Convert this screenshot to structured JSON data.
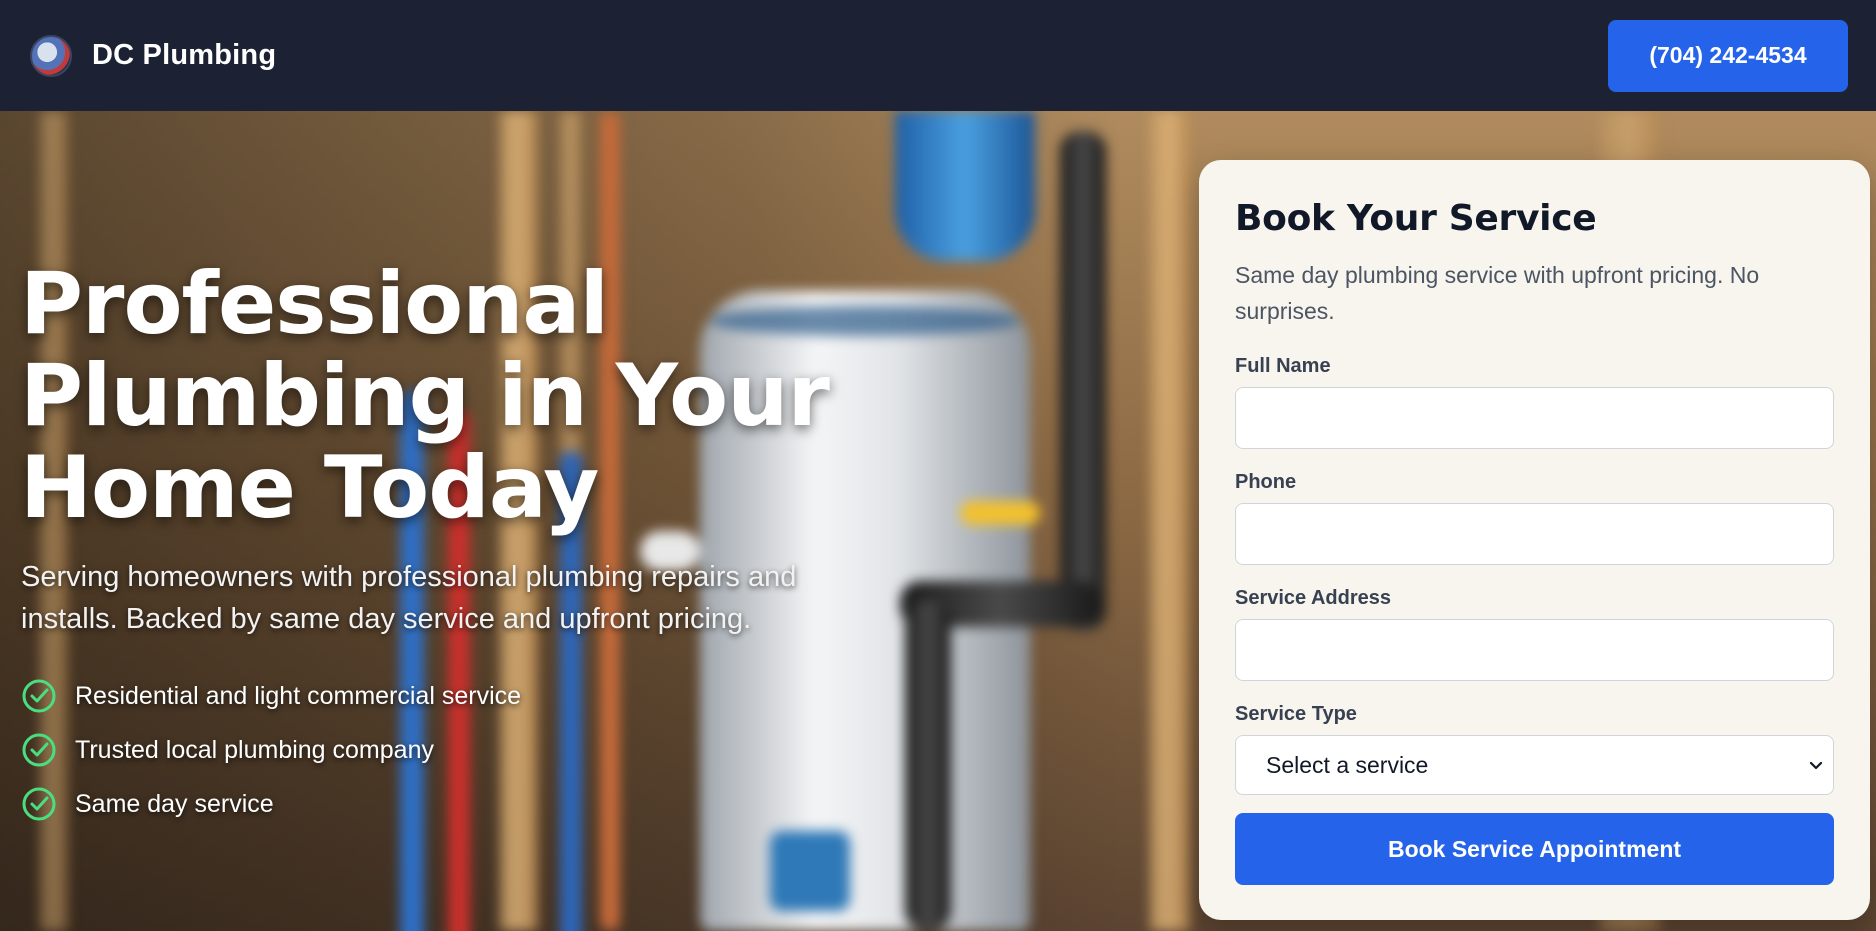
{
  "header": {
    "brand_name": "DC Plumbing",
    "phone_label": "(704) 242-4534"
  },
  "hero": {
    "title": "Professional Plumbing in Your Home Today",
    "subtitle": "Serving homeowners with professional plumbing repairs and installs. Backed by same day service and upfront pricing.",
    "features": [
      "Residential and light commercial service",
      "Trusted local plumbing company",
      "Same day service"
    ]
  },
  "booking": {
    "title": "Book Your Service",
    "subtitle": "Same day plumbing service with upfront pricing. No surprises.",
    "fields": {
      "full_name_label": "Full Name",
      "full_name_value": "",
      "phone_label": "Phone",
      "phone_value": "",
      "address_label": "Service Address",
      "address_value": "",
      "service_type_label": "Service Type",
      "service_type_selected": "Select a service"
    },
    "submit_label": "Book Service Appointment"
  },
  "icons": {
    "logo": "company-logo",
    "feature_check": "check-circle-icon",
    "select_chevron": "chevron-down-icon"
  },
  "colors": {
    "header_bg": "#1c2233",
    "accent": "#2563eb",
    "card_bg": "#f8f5ee",
    "check_green": "#4ade80"
  }
}
